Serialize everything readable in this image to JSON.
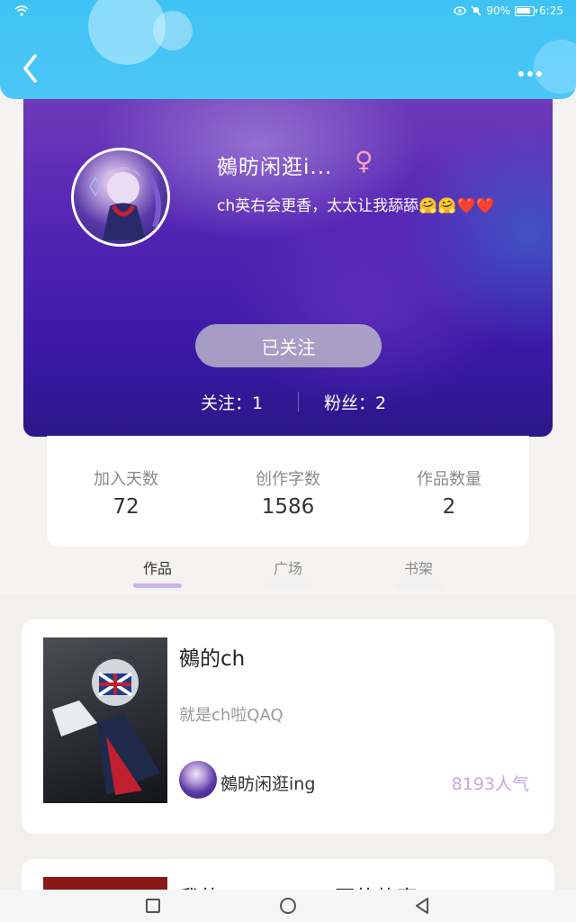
{
  "status_bar": {
    "battery": "90%",
    "time": "6:25"
  },
  "profile": {
    "nickname": "鵺昉闲逛i...",
    "gender_symbol": "♀",
    "signature": "ch英右会更香，太太让我舔舔🤗🤗❤️❤️",
    "follow_button_label": "已关注",
    "following": "关注：1",
    "followers": "粉丝：2"
  },
  "stats": [
    {
      "label": "加入天数",
      "value": "72"
    },
    {
      "label": "创作字数",
      "value": "1586"
    },
    {
      "label": "作品数量",
      "value": "2"
    }
  ],
  "tabs": [
    {
      "label": "作品",
      "active": true
    },
    {
      "label": "广场",
      "active": false
    },
    {
      "label": "书架",
      "active": false
    }
  ],
  "works": [
    {
      "title": "鵺的ch",
      "description": "就是ch啦QAQ",
      "author": "鵺昉闲逛ing",
      "popularity": "8193人气"
    },
    {
      "title": "我的一времени写的故事"
    }
  ],
  "colors": {
    "header_blue": "#4cc6f6",
    "accent_purple": "#c9b3ea",
    "popularity_purple": "#c8a7e2"
  },
  "icons": [
    "wifi-icon",
    "eye-icon",
    "mute-icon",
    "battery-icon",
    "back-icon",
    "more-icon",
    "gender-female-icon",
    "nav-recent-icon",
    "nav-home-icon",
    "nav-back-icon"
  ]
}
